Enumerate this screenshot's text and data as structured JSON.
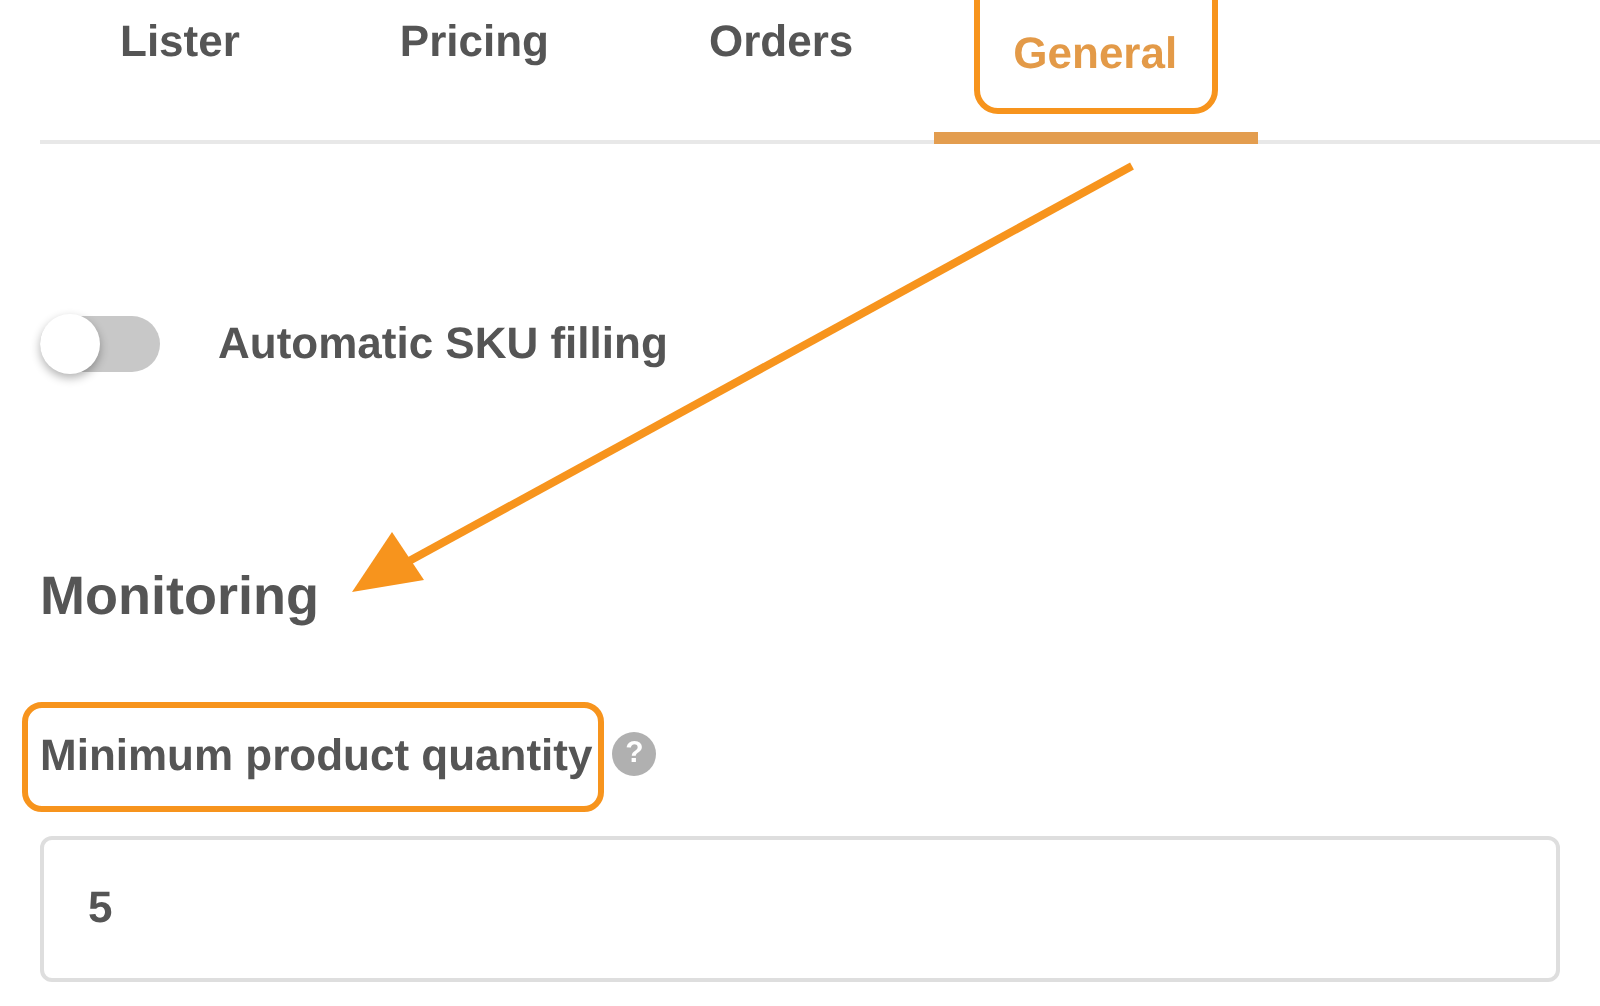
{
  "tabs": [
    {
      "label": "Lister",
      "selected": false,
      "highlighted": false
    },
    {
      "label": "Pricing",
      "selected": false,
      "highlighted": false
    },
    {
      "label": "Orders",
      "selected": false,
      "highlighted": false
    },
    {
      "label": "General",
      "selected": true,
      "highlighted": true
    }
  ],
  "toggle": {
    "label": "Automatic SKU filling",
    "on": false
  },
  "section": {
    "title": "Monitoring",
    "field": {
      "label": "Minimum product quantity",
      "highlighted": true,
      "help": "?",
      "value": "5"
    }
  }
}
